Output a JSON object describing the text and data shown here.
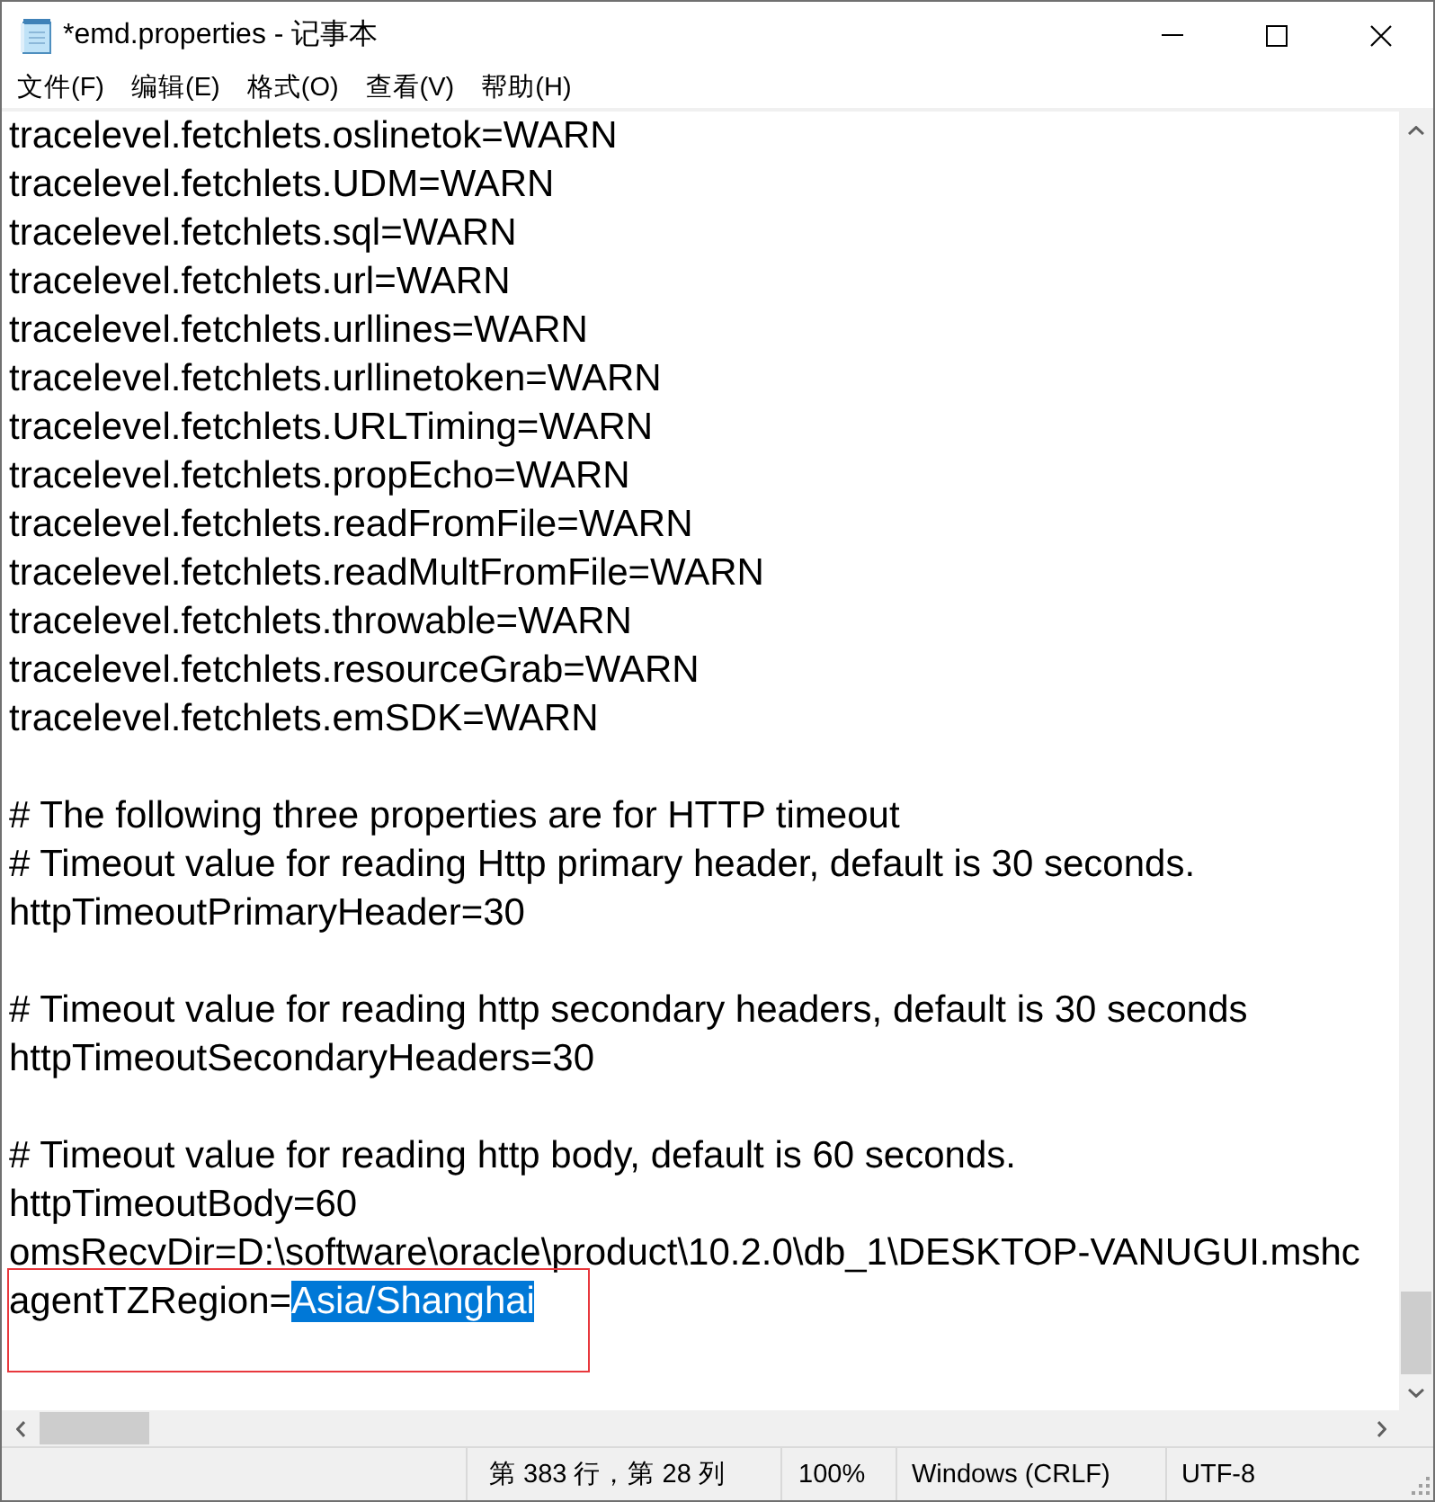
{
  "window": {
    "title": "*emd.properties - 记事本"
  },
  "menu": [
    "文件(F)",
    "编辑(E)",
    "格式(O)",
    "查看(V)",
    "帮助(H)"
  ],
  "editor": {
    "paragraphs": [
      {
        "lines": [
          {
            "text": "tracelevel.fetchlets.oslinetok=WARN",
            "marked": false
          },
          {
            "text": "tracelevel.fetchlets.UDM=WARN",
            "marked": false
          },
          {
            "text": "tracelevel.fetchlets.sql=WARN",
            "marked": false
          },
          {
            "text": "tracelevel.fetchlets.url=WARN",
            "marked": false
          },
          {
            "text": "tracelevel.fetchlets.urllines=WARN",
            "marked": false
          },
          {
            "text": "tracelevel.fetchlets.urllinetoken=WARN",
            "marked": false
          },
          {
            "text": "tracelevel.fetchlets.URLTiming=WARN",
            "marked": false
          },
          {
            "text": "tracelevel.fetchlets.propEcho=WARN",
            "marked": false
          },
          {
            "text": "tracelevel.fetchlets.readFromFile=WARN",
            "marked": false
          },
          {
            "text": "tracelevel.fetchlets.readMultFromFile=WARN",
            "marked": false
          },
          {
            "text": "tracelevel.fetchlets.throwable=WARN",
            "marked": false
          },
          {
            "text": "tracelevel.fetchlets.resourceGrab=WARN",
            "marked": false
          },
          {
            "text": "tracelevel.fetchlets.emSDK=WARN",
            "marked": false
          }
        ]
      },
      {
        "lines": [
          {
            "text": "# The following three properties are for HTTP timeout",
            "marked": false
          },
          {
            "text": "# Timeout value for reading Http primary header, default is 30 seconds.",
            "marked": false
          },
          {
            "text": "httpTimeoutPrimaryHeader=30",
            "marked": false
          }
        ]
      },
      {
        "lines": [
          {
            "text": "# Timeout value for reading http secondary headers, default is 30 seconds",
            "marked": false
          },
          {
            "text": "httpTimeoutSecondaryHeaders=30",
            "marked": false
          }
        ]
      },
      {
        "lines": [
          {
            "text": "# Timeout value for reading http body, default is 60 seconds.",
            "marked": false
          },
          {
            "text": "httpTimeoutBody=60",
            "marked": false
          },
          {
            "text": "omsRecvDir=D:\\software\\oracle\\product\\10.2.0\\db_1\\DESKTOP-VANUGUI.mshc",
            "marked": false
          },
          {
            "text": "agentTZRegion=",
            "selection": "Asia/Shanghai",
            "marked": true
          }
        ]
      }
    ]
  },
  "status_bar": {
    "position": "第 383 行，第 28 列",
    "zoom": "100%",
    "line_ending": "Windows (CRLF)",
    "encoding": "UTF-8"
  }
}
